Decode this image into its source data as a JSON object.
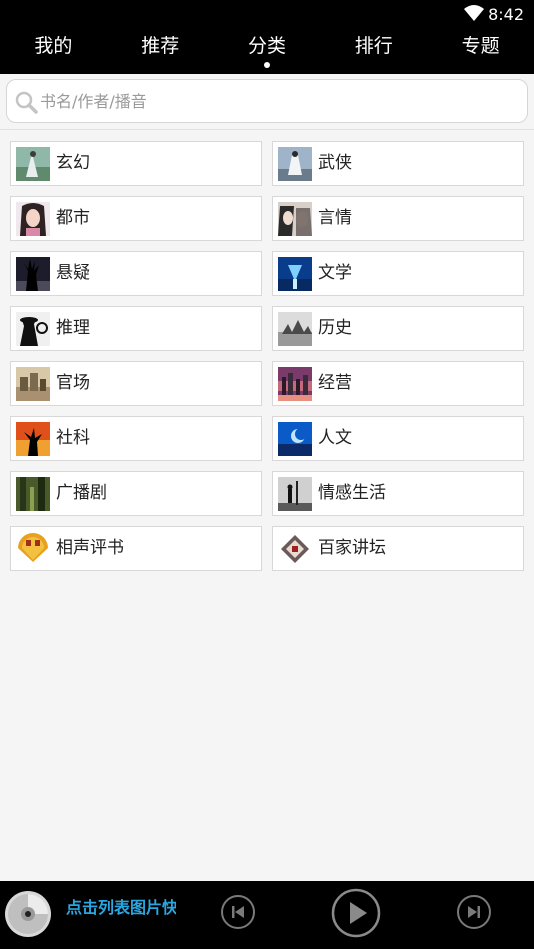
{
  "status": {
    "time": "8:42"
  },
  "nav": {
    "tabs": [
      "我的",
      "推荐",
      "分类",
      "排行",
      "专题"
    ],
    "active": "分类"
  },
  "search": {
    "placeholder": "书名/作者/播音"
  },
  "categories": [
    {
      "label": "玄幻",
      "icon": "fantasy-thumb"
    },
    {
      "label": "武侠",
      "icon": "wuxia-thumb"
    },
    {
      "label": "都市",
      "icon": "urban-thumb"
    },
    {
      "label": "言情",
      "icon": "romance-thumb"
    },
    {
      "label": "悬疑",
      "icon": "suspense-thumb"
    },
    {
      "label": "文学",
      "icon": "literature-thumb"
    },
    {
      "label": "推理",
      "icon": "detective-thumb"
    },
    {
      "label": "历史",
      "icon": "history-thumb"
    },
    {
      "label": "官场",
      "icon": "officialdom-thumb"
    },
    {
      "label": "经营",
      "icon": "business-thumb"
    },
    {
      "label": "社科",
      "icon": "social-science-thumb"
    },
    {
      "label": "人文",
      "icon": "humanities-thumb"
    },
    {
      "label": "广播剧",
      "icon": "radio-drama-thumb"
    },
    {
      "label": "情感生活",
      "icon": "emotional-life-thumb"
    },
    {
      "label": "相声评书",
      "icon": "crosstalk-thumb"
    },
    {
      "label": "百家讲坛",
      "icon": "lecture-room-thumb"
    }
  ],
  "player": {
    "title": "点击列表图片快速播放"
  },
  "colors": {
    "accent": "#2aa6e0",
    "bar": "#000000",
    "background": "#f5f5f5"
  }
}
